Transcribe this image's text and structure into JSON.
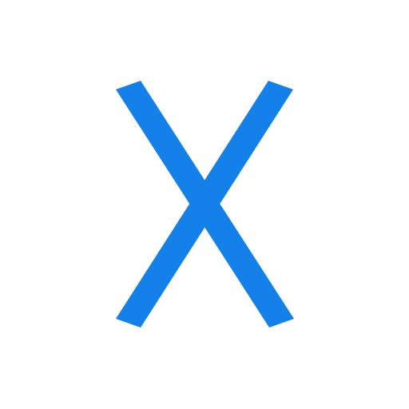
{
  "icon": {
    "name": "close-icon",
    "color": "#1480EA",
    "background": "#FFFFFF"
  }
}
